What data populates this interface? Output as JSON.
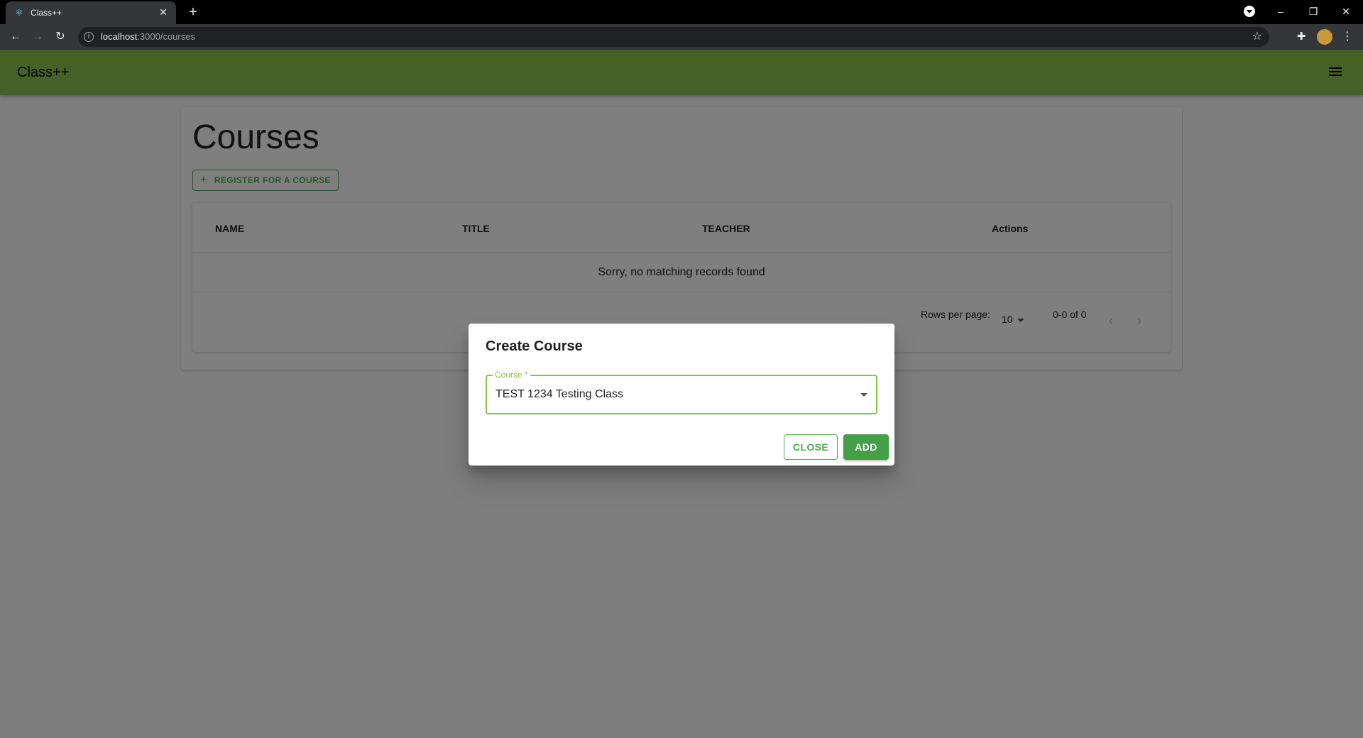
{
  "browser": {
    "tab_title": "Class++",
    "tab_icon": "react-icon",
    "url_host": "localhost",
    "url_rest": ":3000/courses"
  },
  "app": {
    "title": "Class++"
  },
  "page": {
    "title": "Courses",
    "register_button": "REGISTER FOR A COURSE"
  },
  "table": {
    "columns": [
      "NAME",
      "TITLE",
      "TEACHER",
      "Actions"
    ],
    "empty_message": "Sorry, no matching records found",
    "rows_per_page_label": "Rows per page:",
    "rows_per_page_value": "10",
    "range": "0-0 of 0"
  },
  "dialog": {
    "title": "Create Course",
    "field_label": "Course *",
    "field_value": "TEST 1234 Testing Class",
    "close_label": "CLOSE",
    "add_label": "ADD"
  },
  "colors": {
    "appbar": "#8bc34a",
    "primary": "#4caf50",
    "add_button": "#43a047"
  }
}
